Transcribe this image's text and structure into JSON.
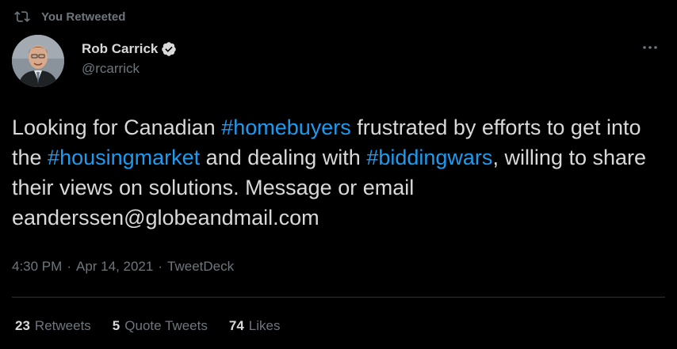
{
  "retweet_banner": {
    "icon": "retweet-icon",
    "text": "You Retweeted"
  },
  "author": {
    "display_name": "Rob Carrick",
    "handle": "@rcarrick",
    "verified": true,
    "verified_icon": "verified-badge-icon"
  },
  "more_icon": "more-icon",
  "tweet": {
    "segments": [
      {
        "text": "Looking for Canadian ",
        "hashtag": false
      },
      {
        "text": "#homebuyers",
        "hashtag": true
      },
      {
        "text": " frustrated by efforts to get into the ",
        "hashtag": false
      },
      {
        "text": "#housingmarket",
        "hashtag": true
      },
      {
        "text": " and dealing with ",
        "hashtag": false
      },
      {
        "text": "#biddingwars",
        "hashtag": true
      },
      {
        "text": ", willing to share their views on solutions. Message or email eanderssen@globeandmail.com",
        "hashtag": false
      }
    ]
  },
  "meta": {
    "time": "4:30 PM",
    "separator": "·",
    "date": "Apr 14, 2021",
    "source": "TweetDeck"
  },
  "stats": {
    "retweets_count": "23",
    "retweets_label": "Retweets",
    "quote_count": "5",
    "quote_label": "Quote Tweets",
    "likes_count": "74",
    "likes_label": "Likes"
  },
  "colors": {
    "background": "#000000",
    "text": "#d9d9d9",
    "muted": "#6e767d",
    "accent": "#1d9bf0",
    "divider": "#2f3336"
  }
}
